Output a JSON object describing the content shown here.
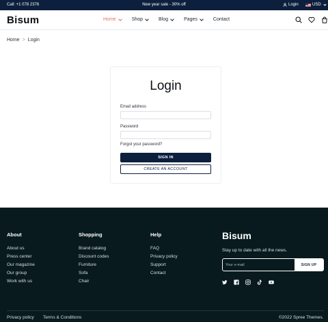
{
  "topbar": {
    "call": "Call: +1 078 2376",
    "promo": "New year sale - 30% off",
    "login": "Login",
    "currency": "USD"
  },
  "header": {
    "logo": "Bisum",
    "nav": [
      {
        "label": "Home",
        "active": true,
        "dropdown": true
      },
      {
        "label": "Shop",
        "active": false,
        "dropdown": true
      },
      {
        "label": "Blog",
        "active": false,
        "dropdown": true
      },
      {
        "label": "Pages",
        "active": false,
        "dropdown": true
      },
      {
        "label": "Contact",
        "active": false,
        "dropdown": false
      }
    ],
    "icons": [
      "search-icon",
      "heart-icon",
      "bag-icon"
    ]
  },
  "breadcrumb": [
    "Home",
    "Login"
  ],
  "login_form": {
    "title": "Login",
    "email_label": "Email address",
    "email_value": "",
    "password_label": "Password",
    "password_value": "",
    "forgot_link": "Forgot your password?",
    "sign_in_button": "SIGN IN",
    "create_account_button": "CREATE AN ACCOUNT"
  },
  "footer": {
    "about": {
      "title": "About",
      "links": [
        "About us",
        "Press center",
        "Our magazine",
        "Our group",
        "Work with us"
      ]
    },
    "shopping": {
      "title": "Shopping",
      "links": [
        "Brand catalog",
        "Discount codes",
        "Furniture",
        "Sofa",
        "Chair"
      ]
    },
    "help": {
      "title": "Help",
      "links": [
        "FAQ",
        "Privacy policy",
        "Support",
        "Contact"
      ]
    },
    "logo": "Bisum",
    "tagline": "Stay up to date with all the news.",
    "newsletter_placeholder": "Your e-mail",
    "newsletter_button": "SIGN UP",
    "social_icons": [
      "twitter-icon",
      "facebook-icon",
      "instagram-icon",
      "tiktok-icon",
      "youtube-icon"
    ],
    "bottom_links": [
      "Privacy policy",
      "Terms & Conditions"
    ],
    "copyright": "©2022 Spree Themes."
  },
  "colors": {
    "navy": "#0c1f3d",
    "footer_bg": "#081a1d",
    "accent": "#e5716a"
  }
}
